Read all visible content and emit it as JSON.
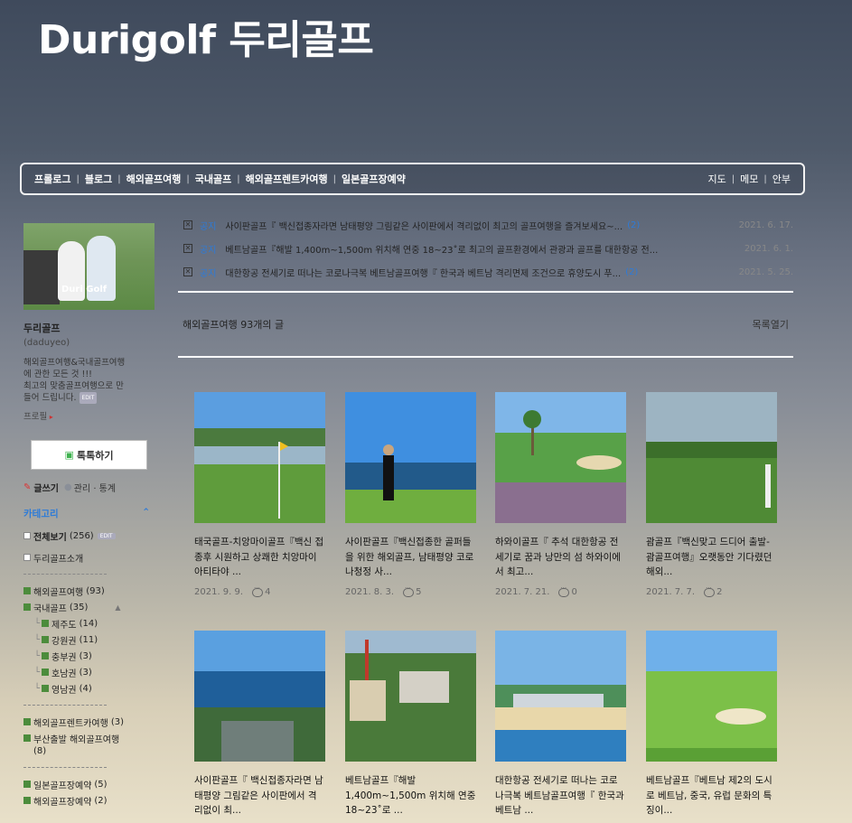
{
  "blog": {
    "title": "Durigolf 두리골프"
  },
  "nav": {
    "left": [
      "프롤로그",
      "블로그",
      "해외골프여행",
      "국내골프",
      "해외골프렌트카여행",
      "일본골프장예약"
    ],
    "right": [
      "지도",
      "메모",
      "안부"
    ]
  },
  "profile": {
    "image_watermark": "Duri Golf",
    "name": "두리골프",
    "id": "(daduyeo)",
    "desc_line1": "해외골프여행&국내골프여행",
    "desc_line2": "에 관한 모든 것 !!!",
    "desc_line3": "최고의 맞춤골프여행으로 만",
    "desc_line4": "들어 드립니다.",
    "edit": "EDIT",
    "profile_link": "프로필",
    "talk_button": "톡톡하기",
    "write": "글쓰기",
    "manage": "관리 · 통계"
  },
  "categories": {
    "header": "카테고리",
    "all": {
      "label": "전체보기",
      "count": "(256)",
      "edit": "EDIT"
    },
    "intro": "두리골프소개",
    "items": [
      {
        "label": "해외골프여행",
        "count": "(93)"
      },
      {
        "label": "국내골프",
        "count": "(35)"
      }
    ],
    "sub": [
      {
        "label": "제주도",
        "count": "(14)"
      },
      {
        "label": "강원권",
        "count": "(11)"
      },
      {
        "label": "충부권",
        "count": "(3)"
      },
      {
        "label": "호남권",
        "count": "(3)"
      },
      {
        "label": "영남권",
        "count": "(4)"
      }
    ],
    "rent": {
      "label": "해외골프렌트카여행",
      "count": "(3)"
    },
    "busan": {
      "label": "부산출발 해외골프여행",
      "count": "(8)"
    },
    "japan1": {
      "label": "일본골프장예약",
      "count": "(5)"
    },
    "japan2": {
      "label": "해외골프장예약",
      "count": "(2)"
    }
  },
  "notices": [
    {
      "tag": "공지",
      "text": "사이판골프『 백신접종자라면 남태평양 그림같은 사이판에서 격리없이 최고의 골프여행을 즐겨보세요~...",
      "count": "(2)",
      "date": "2021. 6. 17."
    },
    {
      "tag": "공지",
      "text": "베트남골프『해발 1,400m~1,500m 위치해 연중 18~23˚로 최고의 골프환경에서 관광과 골프를 대한항공 전...",
      "count": "",
      "date": "2021. 6. 1."
    },
    {
      "tag": "공지",
      "text": "대한항공 전세기로 떠나는 코로나극복 베트남골프여행『 한국과 베트남 격리면제 조건으로 휴양도시 푸...",
      "count": "(2)",
      "date": "2021. 5. 25."
    }
  ],
  "list": {
    "category": "해외골프여행",
    "count_text": "93개의 글",
    "toggle": "목록열기"
  },
  "posts": [
    {
      "title": "태국골프-치앙마이골프『백신 접종후 시원하고 상쾌한 치앙마이 아티타야 ...",
      "date": "2021. 9. 9.",
      "comments": "4"
    },
    {
      "title": "사이판골프『백신접종한 골퍼들을 위한 해외골프, 남태평양 코로나청정 사...",
      "date": "2021. 8. 3.",
      "comments": "5"
    },
    {
      "title": "하와이골프『 추석 대한항공 전세기로 꿈과 낭만의 섬 하와이에서 최고...",
      "date": "2021. 7. 21.",
      "comments": "0"
    },
    {
      "title": "괌골프『백신맞고 드디어 출발- 괌골프여행』오랫동안 기다렸던 해외...",
      "date": "2021. 7. 7.",
      "comments": "2"
    },
    {
      "title": "사이판골프『 백신접종자라면 남태평양 그림같은 사이판에서 격리없이 최...",
      "date": "",
      "comments": ""
    },
    {
      "title": "베트남골프『해발 1,400m~1,500m 위치해 연중 18~23˚로 ...",
      "date": "",
      "comments": ""
    },
    {
      "title": "대한항공 전세기로 떠나는 코로나극복 베트남골프여행『 한국과 베트남 ...",
      "date": "",
      "comments": ""
    },
    {
      "title": "베트남골프『베트남 제2의 도시로 베트남, 중국, 유럽 문화의 특징이...",
      "date": "",
      "comments": ""
    }
  ]
}
